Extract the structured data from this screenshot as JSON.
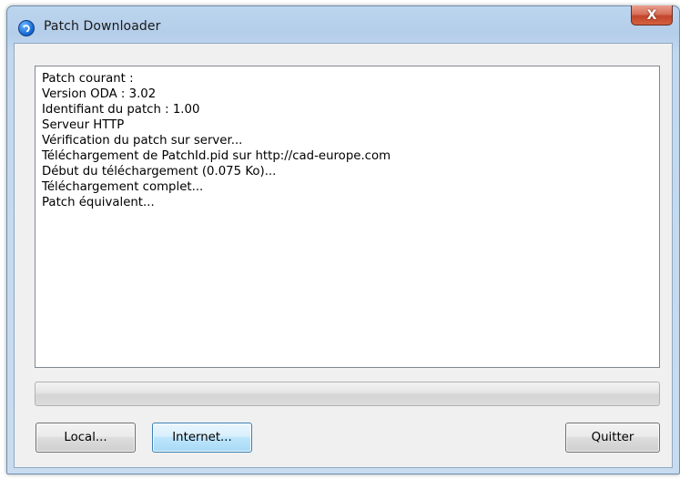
{
  "window": {
    "title": "Patch Downloader",
    "close_label": "X",
    "icon": "app-info-icon"
  },
  "log": {
    "lines": [
      "Patch courant :",
      "Version ODA : 3.02",
      "Identifiant du patch : 1.00",
      "Serveur HTTP",
      "Vérification du patch sur server...",
      "Téléchargement de PatchId.pid sur http://cad-europe.com",
      "Début du téléchargement (0.075 Ko)...",
      "Téléchargement complet...",
      "Patch équivalent..."
    ]
  },
  "progress": {
    "value_percent": 0
  },
  "buttons": {
    "local": "Local...",
    "internet": "Internet...",
    "quit": "Quitter"
  },
  "colors": {
    "close_button": "#c2452c",
    "focused_button_border": "#3c7fb1",
    "frame": "#bcd5ef"
  }
}
